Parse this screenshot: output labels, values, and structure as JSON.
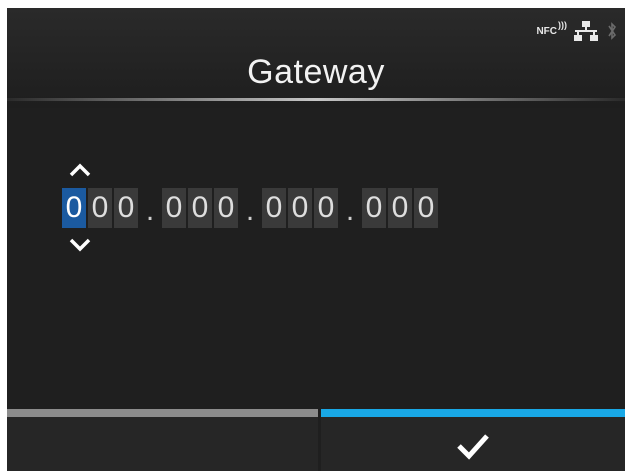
{
  "header": {
    "title": "Gateway",
    "status_icons": {
      "nfc_label": "NFC",
      "nfc_icon": "nfc-icon",
      "network_icon": "wired-network-icon",
      "bluetooth_icon": "bluetooth-icon"
    }
  },
  "ip_editor": {
    "octets": [
      [
        "0",
        "0",
        "0"
      ],
      [
        "0",
        "0",
        "0"
      ],
      [
        "0",
        "0",
        "0"
      ],
      [
        "0",
        "0",
        "0"
      ]
    ],
    "separator": ".",
    "selected_octet": 0,
    "selected_digit": 0,
    "up_icon": "chevron-up-icon",
    "down_icon": "chevron-down-icon"
  },
  "footer": {
    "left_key_icon": "",
    "right_key_icon": "check-icon"
  },
  "colors": {
    "background": "#1f1f1f",
    "digit_box": "#3a3a3a",
    "selected_digit": "#1b5aa0",
    "left_key_bar": "#8c8c8c",
    "right_key_bar": "#19a8e6",
    "text": "#f2f2f2"
  }
}
